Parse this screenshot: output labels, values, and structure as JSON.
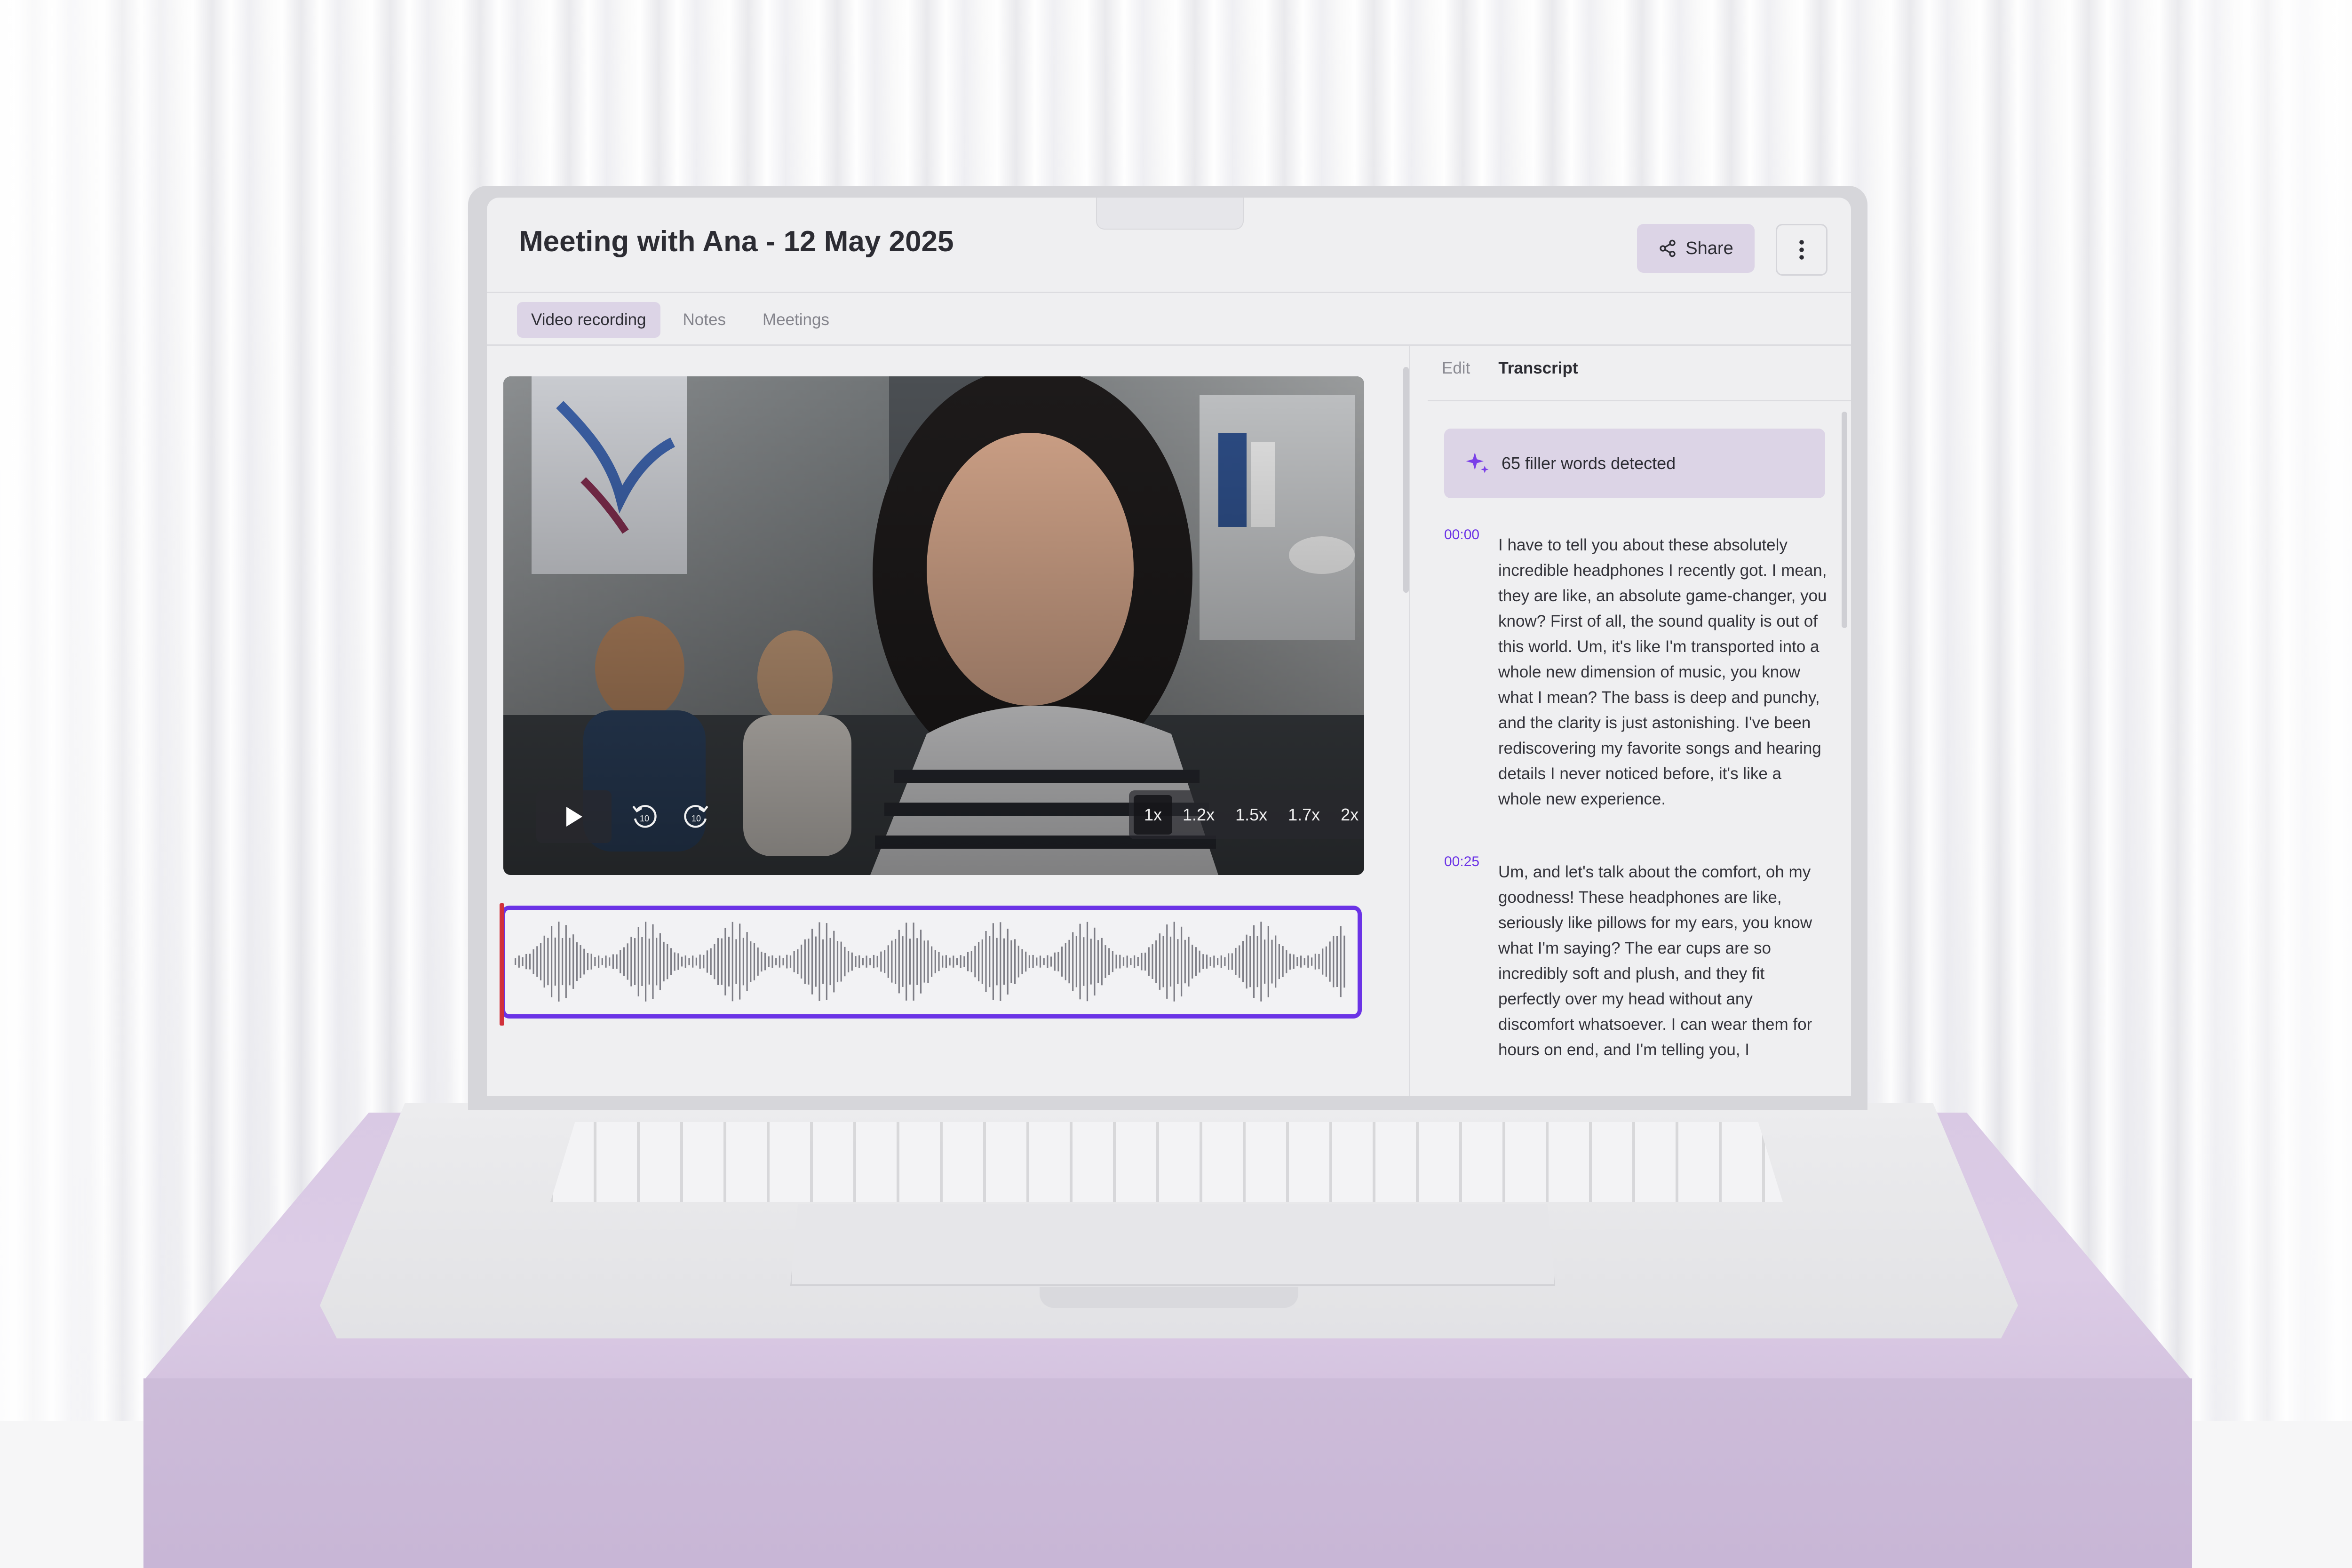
{
  "header": {
    "title": "Meeting with Ana - 12 May 2025",
    "share_label": "Share"
  },
  "tabs": [
    {
      "label": "Video recording",
      "active": true
    },
    {
      "label": "Notes",
      "active": false
    },
    {
      "label": "Meetings",
      "active": false
    }
  ],
  "player": {
    "speeds": [
      "1x",
      "1.2x",
      "1.5x",
      "1.7x",
      "2x"
    ],
    "selected_speed": "1x",
    "skip_back_label": "10",
    "skip_forward_label": "10"
  },
  "right_tabs": [
    {
      "label": "Edit",
      "active": false
    },
    {
      "label": "Transcript",
      "active": true
    }
  ],
  "filler_banner": "65 filler words detected",
  "transcript": [
    {
      "time": "00:00",
      "text": "I have to tell you about these absolutely incredible headphones I recently got. I mean, they are like, an absolute game-changer, you know? First of all, the sound quality is out of this world. Um, it's like I'm transported into a whole new dimension of music, you know what I mean? The bass is deep and punchy, and the clarity is just astonishing. I've been rediscovering my favorite songs and hearing details I never noticed before, it's like a whole new experience."
    },
    {
      "time": "00:25",
      "text": "Um, and let's talk about the comfort, oh my goodness! These headphones are like, seriously like pillows for my ears, you know what I'm saying? The ear cups are so incredibly soft and plush, and they fit perfectly over my head without any discomfort whatsoever. I can wear them for hours on end, and I'm telling you, I"
    }
  ],
  "colors": {
    "accent": "#6b33e6",
    "playhead": "#d1313b",
    "tab_active_bg": "#dcd4e6",
    "pedestal": "#d9c9e4"
  },
  "icons": {
    "share": "share-icon",
    "more": "more-vertical-icon",
    "play": "play-icon",
    "rewind": "rewind-10-icon",
    "forward": "forward-10-icon",
    "sparkle": "sparkle-icon"
  }
}
